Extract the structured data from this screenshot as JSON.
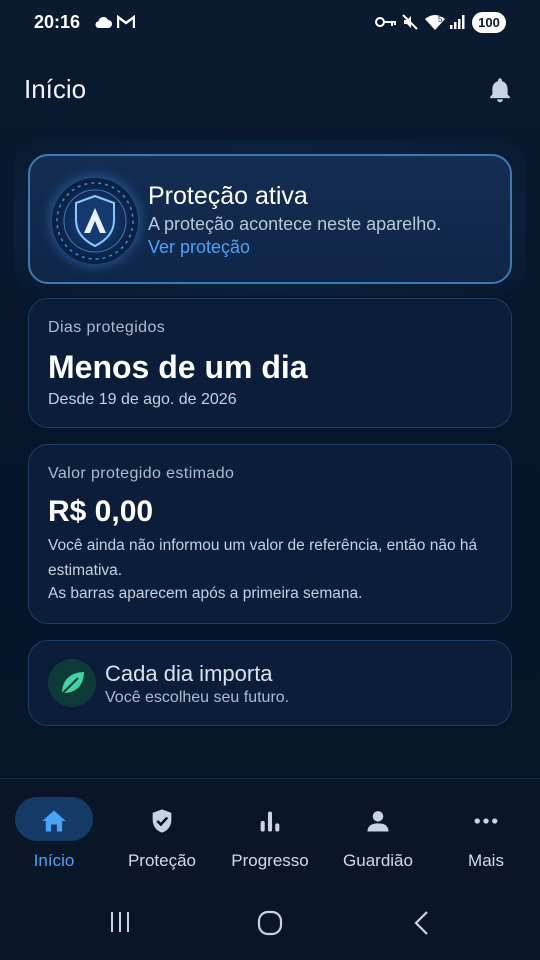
{
  "status_bar": {
    "time": "20:16",
    "battery": "100",
    "icons_left": [
      "cloud-icon",
      "gmail-icon"
    ],
    "icons_right": [
      "key-icon",
      "mute-icon",
      "wifi-icon",
      "signal-icon"
    ]
  },
  "header": {
    "title": "Início",
    "bell_icon": "bell-icon"
  },
  "protection_card": {
    "title": "Proteção ativa",
    "subtitle": "A proteção acontece neste aparelho.",
    "link": "Ver proteção"
  },
  "days_card": {
    "label": "Dias protegidos",
    "value": "Menos de um dia",
    "since": "Desde 19 de ago. de 2026"
  },
  "value_card": {
    "label": "Valor protegido estimado",
    "amount": "R$ 0,00",
    "note": "Você ainda não informou um valor de referência, então não há estimativa.",
    "bars_note": "As barras aparecem após a primeira semana."
  },
  "motto_card": {
    "title": "Cada dia importa",
    "subtitle": "Você escolheu seu futuro."
  },
  "bottom_nav": {
    "items": [
      {
        "label": "Início",
        "icon": "home-icon",
        "active": true
      },
      {
        "label": "Proteção",
        "icon": "shield-check-icon",
        "active": false
      },
      {
        "label": "Progresso",
        "icon": "bar-chart-icon",
        "active": false
      },
      {
        "label": "Guardião",
        "icon": "person-icon",
        "active": false
      },
      {
        "label": "Mais",
        "icon": "more-icon",
        "active": false
      }
    ]
  },
  "colors": {
    "background": "#071528",
    "accent": "#4aa3f5",
    "card_border": "#1d3d66",
    "active_border": "#3d7ab0"
  }
}
